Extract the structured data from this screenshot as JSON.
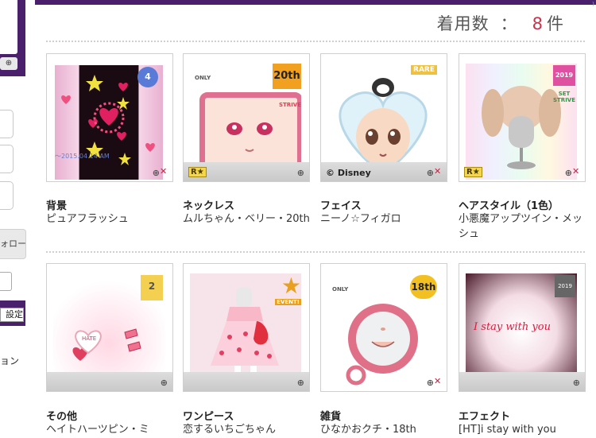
{
  "sidebar": {
    "follow_label": "ォロー",
    "setting_label": "設定",
    "option_label": "ョン"
  },
  "header": {
    "count_label": "着用数",
    "count_sep": "：",
    "count_value": "8",
    "count_unit": "件"
  },
  "items": [
    {
      "category": "背景",
      "name": "ピュアフラッシュ",
      "badge": "4",
      "stamp": "～2015.04.14 AM"
    },
    {
      "category": "ネックレス",
      "name": "ムルちゃん・ベリー・20th",
      "badge": "20th",
      "tag": "ONLY",
      "side": "STRIVE",
      "rank": "R★"
    },
    {
      "category": "フェイス",
      "name": "ニーノ☆フィガロ",
      "badge": "RARE",
      "brand": "© Disney"
    },
    {
      "category": "ヘアスタイル（1色）",
      "name": "小悪魔アップツイン・メッシュ",
      "badge": "2019",
      "side": "SET STRIVE",
      "rank": "R★"
    },
    {
      "category": "その他",
      "name": "ヘイトハーツピン・ミ",
      "badge": "2",
      "sticker": "HATE"
    },
    {
      "category": "ワンピース",
      "name": "恋するいちごちゃん",
      "badge": "EVENT!"
    },
    {
      "category": "雑貨",
      "name": "ひなかおクチ・18th",
      "badge": "18th",
      "tag": "ONLY"
    },
    {
      "category": "エフェクト",
      "name": "[HT]i stay with you",
      "badge": "2019",
      "script": "I stay with you"
    }
  ],
  "icons": {
    "zoom": "zoom-icon",
    "drop": "trash-icon"
  },
  "colors": {
    "accent": "#4a1f6b",
    "count": "#d0304a"
  }
}
